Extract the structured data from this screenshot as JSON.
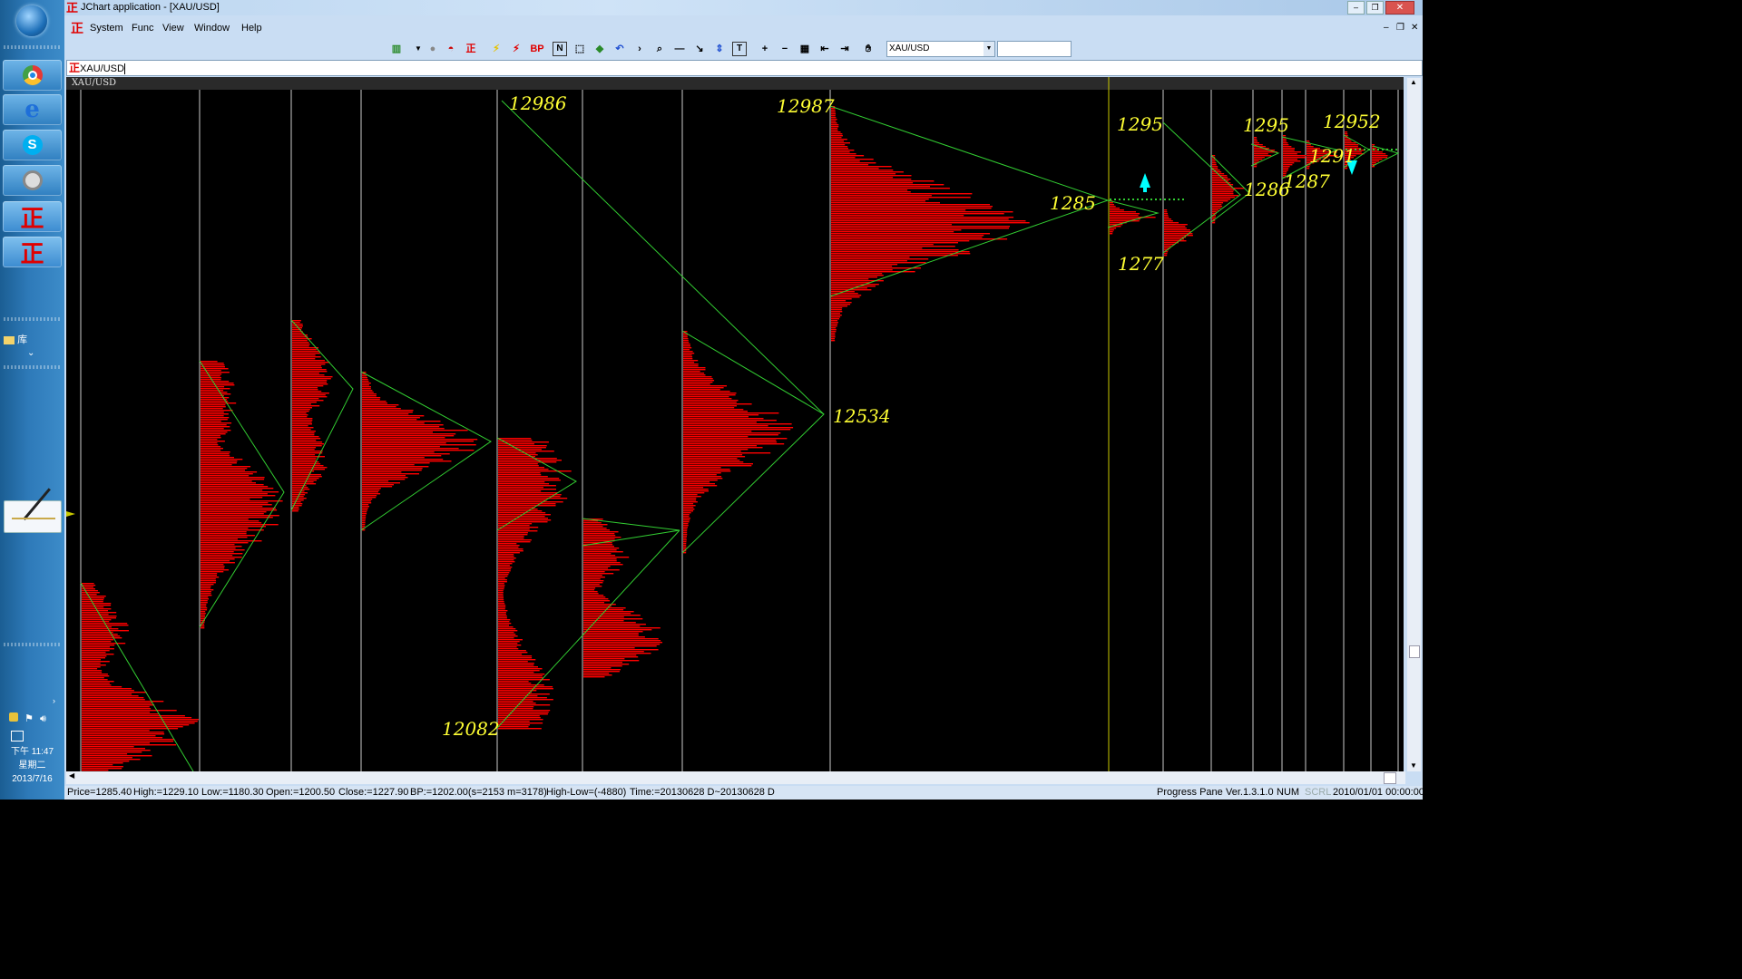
{
  "window": {
    "title": "JChart application - [XAU/USD]"
  },
  "menu": [
    "System",
    "Func",
    "View",
    "Window",
    "Help"
  ],
  "toolbar": {
    "symbol_select": "XAU/USD",
    "bp_label": "BP"
  },
  "symbol_input": "XAU/USD",
  "chart": {
    "header": "XAU/USD",
    "labels": [
      "12986",
      "12987",
      "1295",
      "1295",
      "12952",
      "1291",
      "1287",
      "1286",
      "1285",
      "1277",
      "12534",
      "12082"
    ]
  },
  "status": {
    "price": "Price=1285.40",
    "high": "High:=1229.10",
    "low": "Low:=1180.30",
    "open": "Open:=1200.50",
    "close": "Close:=1227.90",
    "bp": "BP:=1202.00(s=2153 m=3178)",
    "highlow": "High-Low=(-4880)",
    "time": "Time:=20130628 D~20130628 D",
    "pane": "Progress Pane",
    "version": "Ver.1.3.1.0",
    "num": "NUM",
    "scrl": "SCRL",
    "datetime": "2010/01/01 00:00:00"
  },
  "taskbar": {
    "tray_time": "下午 11:47",
    "tray_day": "星期二",
    "tray_date": "2013/7/16",
    "library": "库"
  },
  "colors": {
    "profile": "#ff0000",
    "trendline": "#32cd32",
    "label": "#ffff33",
    "separator": "#ffffff",
    "marker": "#00ffff"
  }
}
